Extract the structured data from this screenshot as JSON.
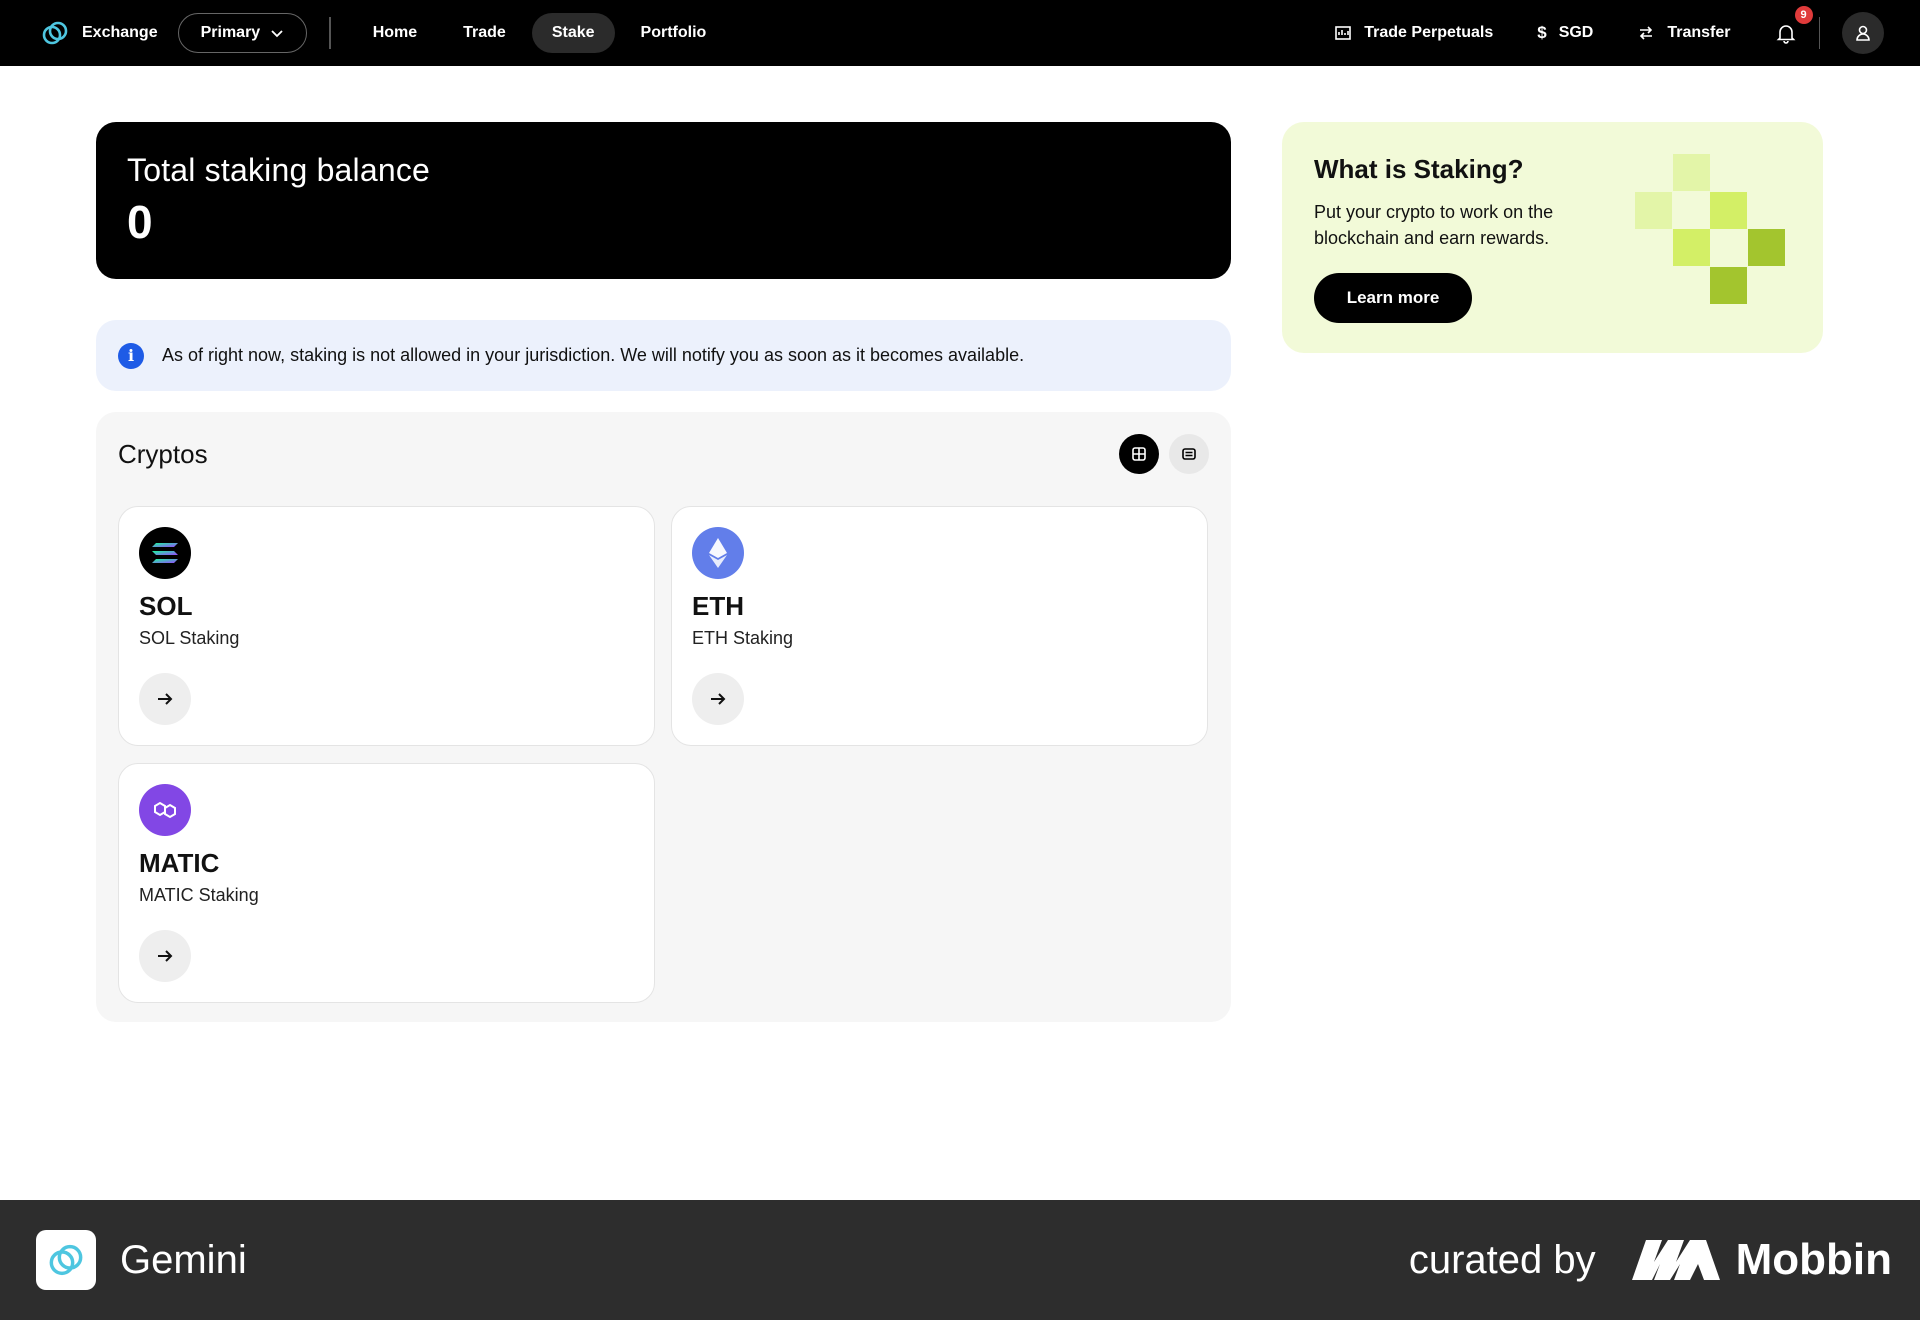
{
  "header": {
    "brand": "Exchange",
    "account_selector": "Primary",
    "nav": [
      {
        "label": "Home",
        "active": false
      },
      {
        "label": "Trade",
        "active": false
      },
      {
        "label": "Stake",
        "active": true
      },
      {
        "label": "Portfolio",
        "active": false
      }
    ],
    "right": {
      "trade_perpetuals": "Trade Perpetuals",
      "currency": "SGD",
      "transfer": "Transfer",
      "notification_count": "9"
    }
  },
  "balance": {
    "title": "Total staking balance",
    "value": "0"
  },
  "notice": {
    "text": "As of right now, staking is not allowed in your jurisdiction. We will notify you as soon as it becomes available."
  },
  "cryptos": {
    "title": "Cryptos",
    "items": [
      {
        "symbol": "SOL",
        "subtitle": "SOL Staking",
        "icon": "solana-icon",
        "color": "#000000"
      },
      {
        "symbol": "ETH",
        "subtitle": "ETH Staking",
        "icon": "ethereum-icon",
        "color": "#627EEA"
      },
      {
        "symbol": "MATIC",
        "subtitle": "MATIC Staking",
        "icon": "polygon-icon",
        "color": "#8247E5"
      }
    ]
  },
  "promo": {
    "title": "What is Staking?",
    "text": "Put your crypto to work on the blockchain and earn rewards.",
    "button": "Learn more"
  },
  "footer": {
    "app_name": "Gemini",
    "curated_by": "curated by",
    "mobbin": "Mobbin"
  },
  "colors": {
    "accent": "#000000",
    "notice_bg": "#ECF1FC",
    "info_blue": "#1E5BE6",
    "promo_bg": "#F2FAD8",
    "lime": "#C8E94E"
  }
}
